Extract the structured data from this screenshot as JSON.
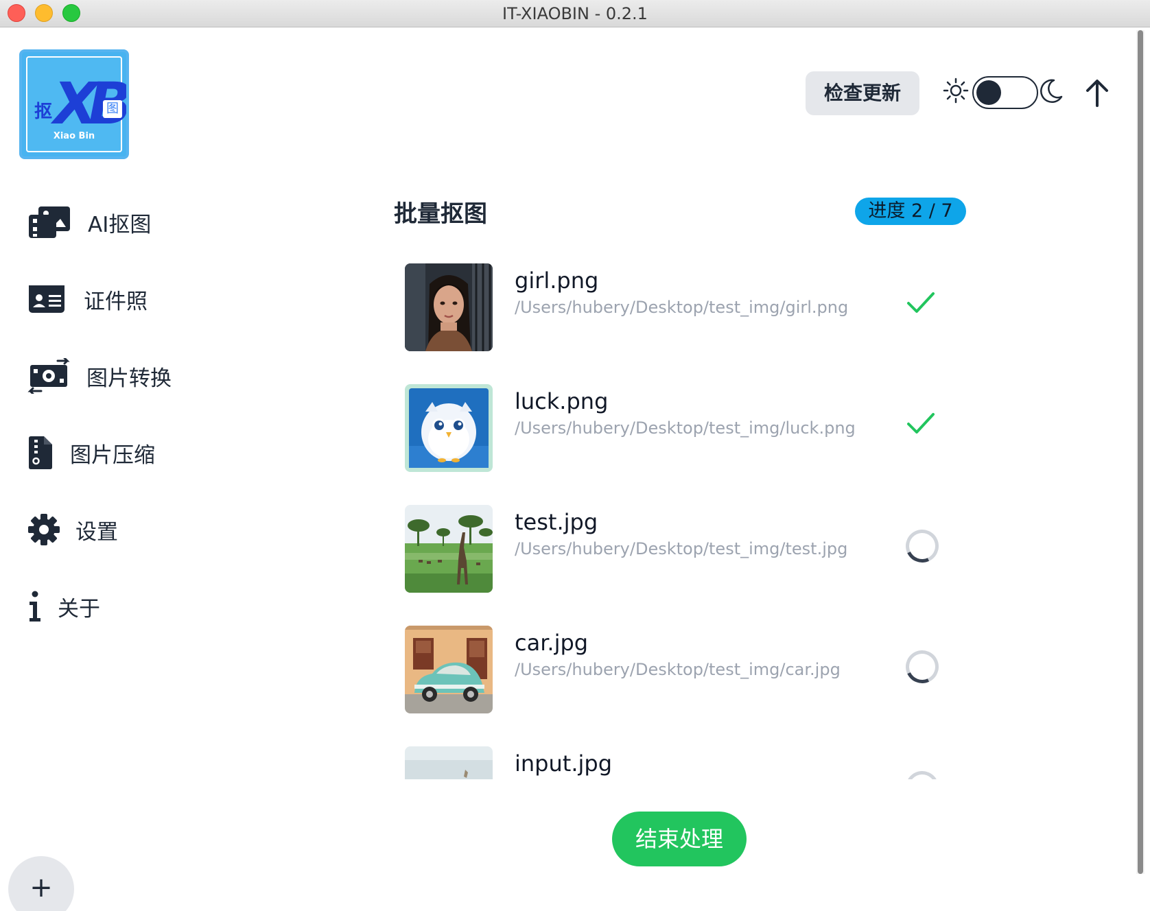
{
  "window": {
    "title": "IT-XIAOBIN - 0.2.1"
  },
  "logo": {
    "big_text": "XB",
    "left_char": "抠",
    "right_char": "图",
    "subtitle": "Xiao Bin"
  },
  "header": {
    "check_update_label": "检查更新",
    "theme_toggle_state": "light",
    "icons": [
      "sun-icon",
      "moon-icon",
      "arrow-up-icon"
    ]
  },
  "sidebar": {
    "items": [
      {
        "label": "AI抠图",
        "icon": "images-icon"
      },
      {
        "label": "证件照",
        "icon": "id-card-icon"
      },
      {
        "label": "图片转换",
        "icon": "money-bill-transfer-icon"
      },
      {
        "label": "图片压缩",
        "icon": "file-zipper-icon"
      },
      {
        "label": "设置",
        "icon": "gear-icon"
      },
      {
        "label": "关于",
        "icon": "info-icon"
      }
    ]
  },
  "main": {
    "title": "批量抠图",
    "progress_label": "进度 2 / 7",
    "progress": {
      "done": 2,
      "total": 7
    },
    "files": [
      {
        "name": "girl.png",
        "path": "/Users/hubery/Desktop/test_img/girl.png",
        "status": "done"
      },
      {
        "name": "luck.png",
        "path": "/Users/hubery/Desktop/test_img/luck.png",
        "status": "done"
      },
      {
        "name": "test.jpg",
        "path": "/Users/hubery/Desktop/test_img/test.jpg",
        "status": "processing"
      },
      {
        "name": "car.jpg",
        "path": "/Users/hubery/Desktop/test_img/car.jpg",
        "status": "processing"
      },
      {
        "name": "input.jpg",
        "path": "",
        "status": "processing"
      }
    ],
    "end_button_label": "结束处理"
  },
  "fab": {
    "label": "+"
  },
  "colors": {
    "accent_blue": "#0ea5e9",
    "success_green": "#22c55e",
    "text_dark": "#1f2937",
    "path_gray": "#9ca3af"
  }
}
